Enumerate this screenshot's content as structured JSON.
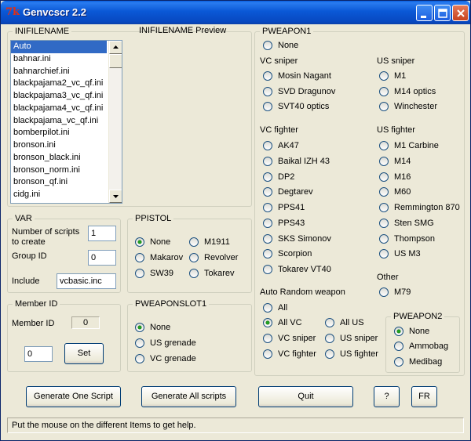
{
  "window": {
    "title": "Genvcscr 2.2",
    "icon_glyph": "7k"
  },
  "inifile": {
    "legend": "INIFILENAME",
    "preview_legend": "INIFILENAME Preview",
    "items": [
      "Auto",
      "bahnar.ini",
      "bahnarchief.ini",
      "blackpajama2_vc_qf.ini",
      "blackpajama3_vc_qf.ini",
      "blackpajama4_vc_qf.ini",
      "blackpajama_vc_qf.ini",
      "bomberpilot.ini",
      "bronson.ini",
      "bronson_black.ini",
      "bronson_norm.ini",
      "bronson_qf.ini",
      "cidg.ini"
    ],
    "selected": "Auto"
  },
  "var": {
    "legend": "VAR",
    "num_scripts_label_1": "Number of scripts",
    "num_scripts_label_2": "to create",
    "num_scripts_value": "1",
    "group_id_label": "Group ID",
    "group_id_value": "0",
    "include_label": "Include",
    "include_value": "vcbasic.inc"
  },
  "member": {
    "legend": "Member ID",
    "label": "Member ID",
    "value": "0",
    "input_value": "0",
    "set_label": "Set"
  },
  "ppistol": {
    "legend": "PPISTOL",
    "none": "None",
    "m1911": "M1911",
    "makarov": "Makarov",
    "revolver": "Revolver",
    "sw39": "SW39",
    "tokarev": "Tokarev"
  },
  "slot1": {
    "legend": "PWEAPONSLOT1",
    "none": "None",
    "us_grenade": "US grenade",
    "vc_grenade": "VC grenade"
  },
  "pweapon1": {
    "legend": "PWEAPON1",
    "none": "None",
    "vc_sniper_heading": "VC sniper",
    "vc_sniper": [
      "Mosin Nagant",
      "SVD Dragunov",
      "SVT40 optics"
    ],
    "us_sniper_heading": "US sniper",
    "us_sniper": [
      "M1",
      "M14 optics",
      "Winchester"
    ],
    "vc_fighter_heading": "VC fighter",
    "vc_fighter": [
      "AK47",
      "Baikal IZH 43",
      "DP2",
      "Degtarev",
      "PPS41",
      "PPS43",
      "SKS Simonov",
      "Scorpion",
      "Tokarev VT40"
    ],
    "us_fighter_heading": "US fighter",
    "us_fighter": [
      "M1 Carbine",
      "M14",
      "M16",
      "M60",
      "Remmington 870",
      "Sten SMG",
      "Thompson",
      "US M3"
    ],
    "other_heading": "Other",
    "other": [
      "M79"
    ],
    "auto_heading": "Auto Random weapon",
    "auto_all": "All",
    "auto_all_vc": "All VC",
    "auto_all_us": "All US",
    "auto_vc_sniper": "VC sniper",
    "auto_us_sniper": "US sniper",
    "auto_vc_fighter": "VC fighter",
    "auto_us_fighter": "US fighter"
  },
  "pweapon2": {
    "legend": "PWEAPON2",
    "none": "None",
    "ammobag": "Ammobag",
    "medibag": "Medibag"
  },
  "buttons": {
    "gen_one": "Generate One Script",
    "gen_all": "Generate All scripts",
    "quit": "Quit",
    "help": "?",
    "fr": "FR"
  },
  "status": "Put the mouse on the different Items to get help."
}
